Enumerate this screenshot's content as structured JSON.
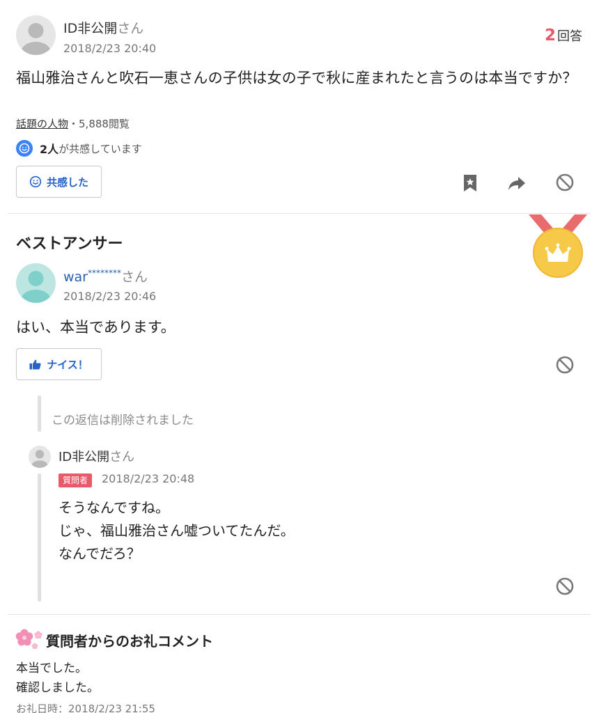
{
  "question": {
    "user": "ID非公開",
    "san": "さん",
    "date": "2018/2/23 20:40",
    "answer_count": "2",
    "answer_label": "回答",
    "body": "福山雅治さんと吹石一恵さんの子供は女の子で秋に産まれたと言うのは本当ですか？",
    "category": "話題の人物",
    "views": "・5,888閲覧",
    "empathy_count": "2人",
    "empathy_text": "が共感しています",
    "empathy_button": "共感した"
  },
  "best_answer": {
    "title": "ベストアンサー",
    "user": "war",
    "masked": "********",
    "san": "さん",
    "date": "2018/2/23 20:46",
    "body": "はい、本当であります。",
    "nice_button": "ナイス！"
  },
  "replies": {
    "deleted_text": "この返信は削除されました",
    "reply": {
      "user": "ID非公開",
      "san": "さん",
      "tag": "質問者",
      "date": "2018/2/23 20:48",
      "lines": [
        "そうなんですね。",
        "じゃ、福山雅治さん嘘ついてたんだ。",
        "なんでだろ？"
      ]
    }
  },
  "thanks": {
    "title": "質問者からのお礼コメント",
    "lines": [
      "本当でした。",
      "確認しました。"
    ],
    "date": "お礼日時：2018/2/23 21:55"
  },
  "colors": {
    "accent_red": "#e8596a",
    "link_blue": "#2563c9",
    "empathy_blue": "#3b82f6",
    "medal_gold": "#f7c948",
    "ribbon_red": "#e96b6b"
  },
  "icons": [
    "user-avatar-icon",
    "smile-icon",
    "bookmark-icon",
    "share-icon",
    "report-icon",
    "medal-icon",
    "thumbs-up-icon",
    "sakura-icon"
  ]
}
